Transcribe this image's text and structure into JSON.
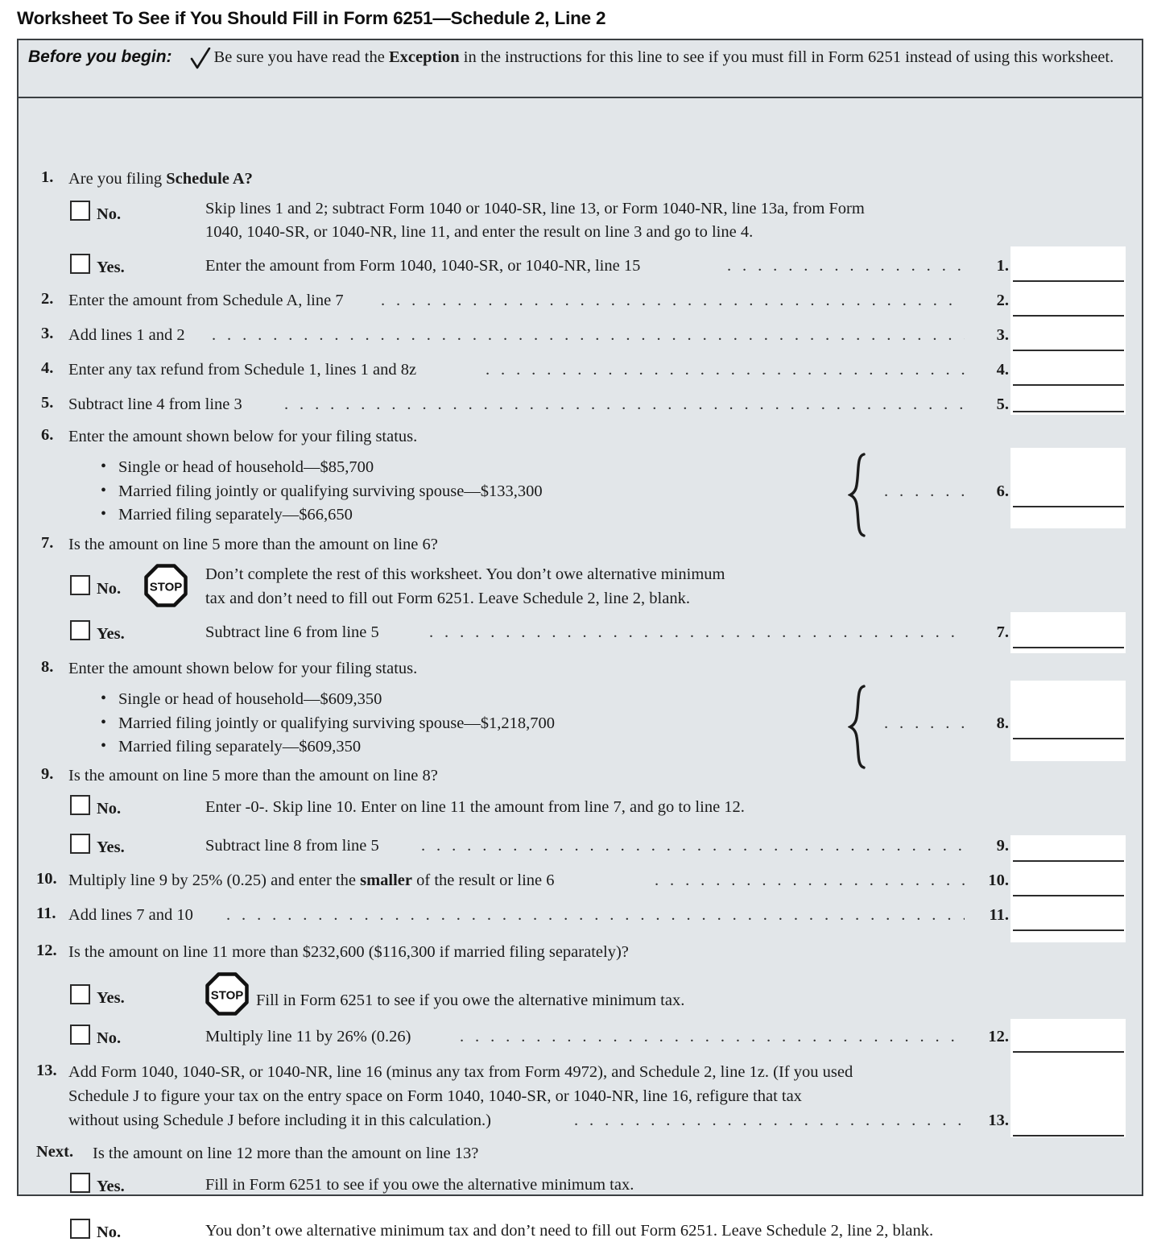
{
  "title": "Worksheet To See if You Should Fill in Form 6251—Schedule 2, Line 2",
  "before_you_begin": {
    "label": "Before you begin:",
    "icon": "check-mark",
    "text_part1": "Be sure you have read the ",
    "text_bold": "Exception",
    "text_part2": " in the instructions for this line to see if you must fill in Form 6251 instead of using this worksheet."
  },
  "lines": {
    "l1": {
      "num": "1.",
      "question_pre": "Are you filing ",
      "question_bold": "Schedule A?",
      "no_label": "No.",
      "no_text_line1": "Skip lines 1 and 2; subtract Form 1040 or 1040-SR, line 13, or Form 1040-NR, line 13a, from Form",
      "no_text_line2": "1040, 1040-SR, or 1040-NR, line 11, and enter the result on line 3 and go to line 4.",
      "yes_label": "Yes.",
      "yes_text": "Enter the amount from Form 1040, 1040-SR, or 1040-NR, line 15",
      "box_num": "1."
    },
    "l2": {
      "num": "2.",
      "text": "Enter the amount from Schedule A, line 7",
      "box_num": "2."
    },
    "l3": {
      "num": "3.",
      "text": "Add lines 1 and 2",
      "box_num": "3."
    },
    "l4": {
      "num": "4.",
      "text": "Enter any tax refund from Schedule 1, lines 1 and 8z",
      "box_num": "4."
    },
    "l5": {
      "num": "5.",
      "text": "Subtract line 4 from line 3",
      "box_num": "5."
    },
    "l6": {
      "num": "6.",
      "text": "Enter the amount shown below for your filing status.",
      "bullets": [
        "Single or head of household—$85,700",
        "Married filing jointly or qualifying surviving spouse—$133,300",
        "Married filing separately—$66,650"
      ],
      "box_num": "6."
    },
    "l7": {
      "num": "7.",
      "question": "Is the amount on line 5 more than the amount on line 6?",
      "no_label": "No.",
      "no_icon": "stop-sign",
      "no_text_line1": "Don’t complete the rest of this worksheet. You don’t owe alternative minimum",
      "no_text_line2": "tax and don’t need to fill out Form 6251. Leave Schedule 2, line 2, blank.",
      "yes_label": "Yes.",
      "yes_text": "Subtract line 6 from line 5",
      "box_num": "7."
    },
    "l8": {
      "num": "8.",
      "text": "Enter the amount shown below for your filing status.",
      "bullets": [
        "Single or head of household—$609,350",
        "Married filing jointly or qualifying surviving spouse—$1,218,700",
        "Married filing separately—$609,350"
      ],
      "box_num": "8."
    },
    "l9": {
      "num": "9.",
      "question": "Is the amount on line 5 more than the amount on line 8?",
      "no_label": "No.",
      "no_text": "Enter -0-. Skip line 10. Enter on line 11 the amount from line 7, and go to line 12.",
      "yes_label": "Yes.",
      "yes_text": "Subtract line 8 from line 5",
      "box_num": "9."
    },
    "l10": {
      "num": "10.",
      "text_pre": "Multiply line 9 by 25% (0.25) and enter the ",
      "text_bold": "smaller",
      "text_post": " of the result or line 6",
      "box_num": "10."
    },
    "l11": {
      "num": "11.",
      "text": "Add lines 7 and 10",
      "box_num": "11."
    },
    "l12": {
      "num": "12.",
      "question": "Is the amount on line 11 more than $232,600 ($116,300 if married filing separately)?",
      "yes_label": "Yes.",
      "yes_icon": "stop-sign",
      "yes_text": "Fill in Form 6251 to see if you owe the alternative minimum tax.",
      "no_label": "No.",
      "no_text": "Multiply line 11 by 26% (0.26)",
      "box_num": "12."
    },
    "l13": {
      "num": "13.",
      "text_line1": "Add Form 1040, 1040-SR, or 1040-NR, line 16 (minus any tax from Form 4972), and Schedule 2, line 1z. (If you used",
      "text_line2": "Schedule J to figure your tax on the entry space on Form 1040, 1040-SR, or 1040-NR, line 16, refigure that tax",
      "text_line3": "without using Schedule J before including it in this calculation.)",
      "box_num": "13."
    },
    "next": {
      "num": "Next.",
      "question": "Is the amount on line 12 more than the amount on line 13?",
      "yes_label": "Yes.",
      "yes_text": "Fill in Form 6251 to see if you owe the alternative minimum tax.",
      "no_label": "No.",
      "no_text": "You don’t owe alternative minimum tax and don’t need to fill out Form 6251. Leave Schedule 2, line 2, blank."
    }
  },
  "stop_sign_text": "STOP",
  "leader_dots": ". . . . . . . . . . . . . . . . . . . . . . . . . . . . . . . . . . . . . . . . . . . . . . . . . . . . . . . . . . . . . . . . . . . . . . . . . . . . . . . . . . . . . . . . . . . . . . . . . .",
  "colors": {
    "worksheet_bg": "#e2e6e9",
    "border": "#3b3f42",
    "box_bg": "#ffffff",
    "text": "#1b1b1b"
  }
}
